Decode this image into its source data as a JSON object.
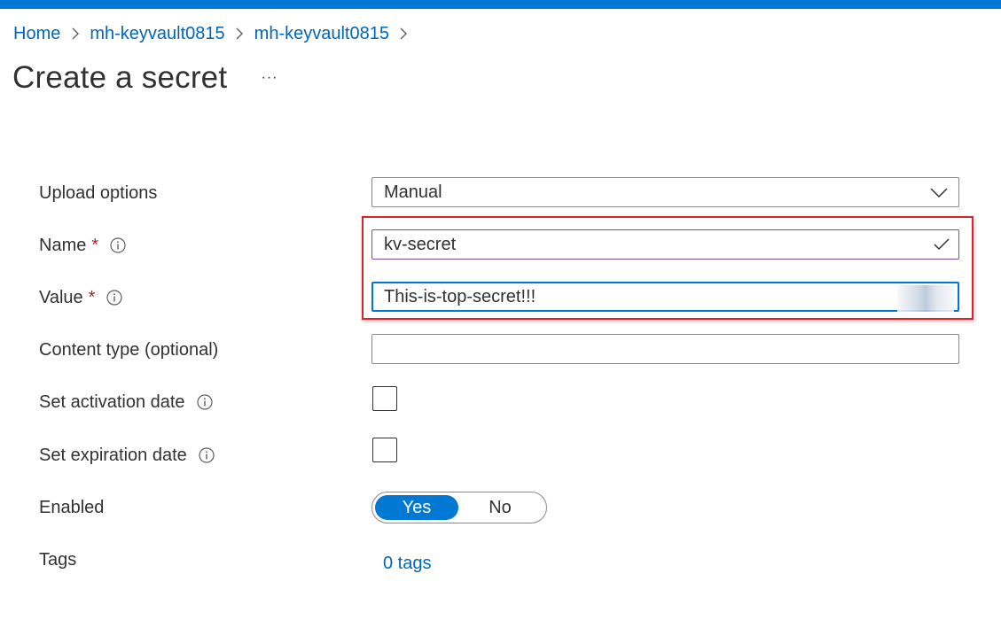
{
  "breadcrumb": {
    "items": [
      {
        "label": "Home"
      },
      {
        "label": "mh-keyvault0815"
      },
      {
        "label": "mh-keyvault0815"
      }
    ]
  },
  "page": {
    "title": "Create a secret",
    "more_label": "···"
  },
  "form": {
    "upload_options": {
      "label": "Upload options",
      "value": "Manual"
    },
    "name": {
      "label": "Name",
      "required_mark": "*",
      "value": "kv-secret"
    },
    "value": {
      "label": "Value",
      "required_mark": "*",
      "value": "This-is-top-secret!!!"
    },
    "content_type": {
      "label": "Content type (optional)",
      "value": ""
    },
    "activation_date": {
      "label": "Set activation date",
      "checked": false
    },
    "expiration_date": {
      "label": "Set expiration date",
      "checked": false
    },
    "enabled": {
      "label": "Enabled",
      "options": [
        "Yes",
        "No"
      ],
      "selected": "Yes"
    },
    "tags": {
      "label": "Tags",
      "link": "0 tags"
    }
  },
  "colors": {
    "accent": "#0078d4",
    "link": "#0067b8",
    "required": "#a4262c",
    "highlight": "#d9232d"
  },
  "icons": {
    "breadcrumb_separator": "chevron-right-icon",
    "info": "info-icon",
    "dropdown": "chevron-down-icon",
    "valid": "checkmark-icon"
  }
}
